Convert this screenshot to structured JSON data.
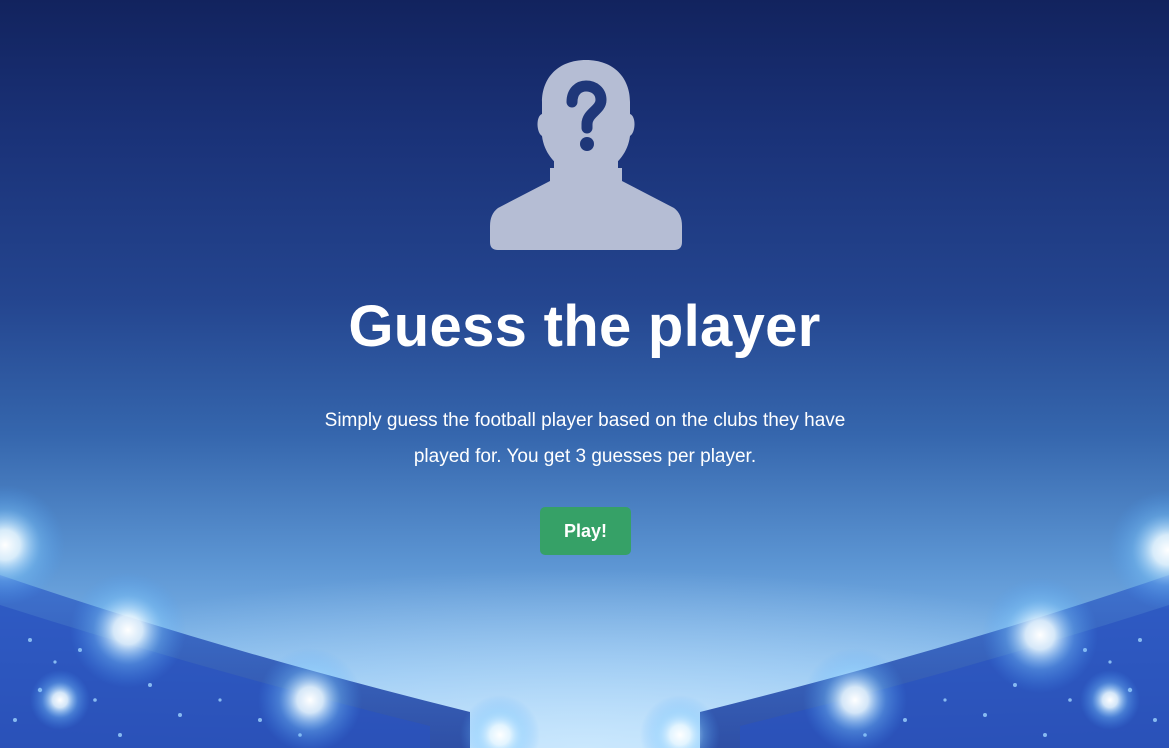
{
  "hero": {
    "avatar_icon": "unknown-player-silhouette-question-icon",
    "title": "Guess the player",
    "description": "Simply guess the football player based on the clubs they have played for. You get 3 guesses per player.",
    "play_label": "Play!"
  },
  "colors": {
    "background_top": "#12235e",
    "background_bottom": "#a9d6fa",
    "avatar_fill": "#b5bdd4",
    "question_mark": "#1f3779",
    "button": "#36a167",
    "text": "#ffffff"
  }
}
